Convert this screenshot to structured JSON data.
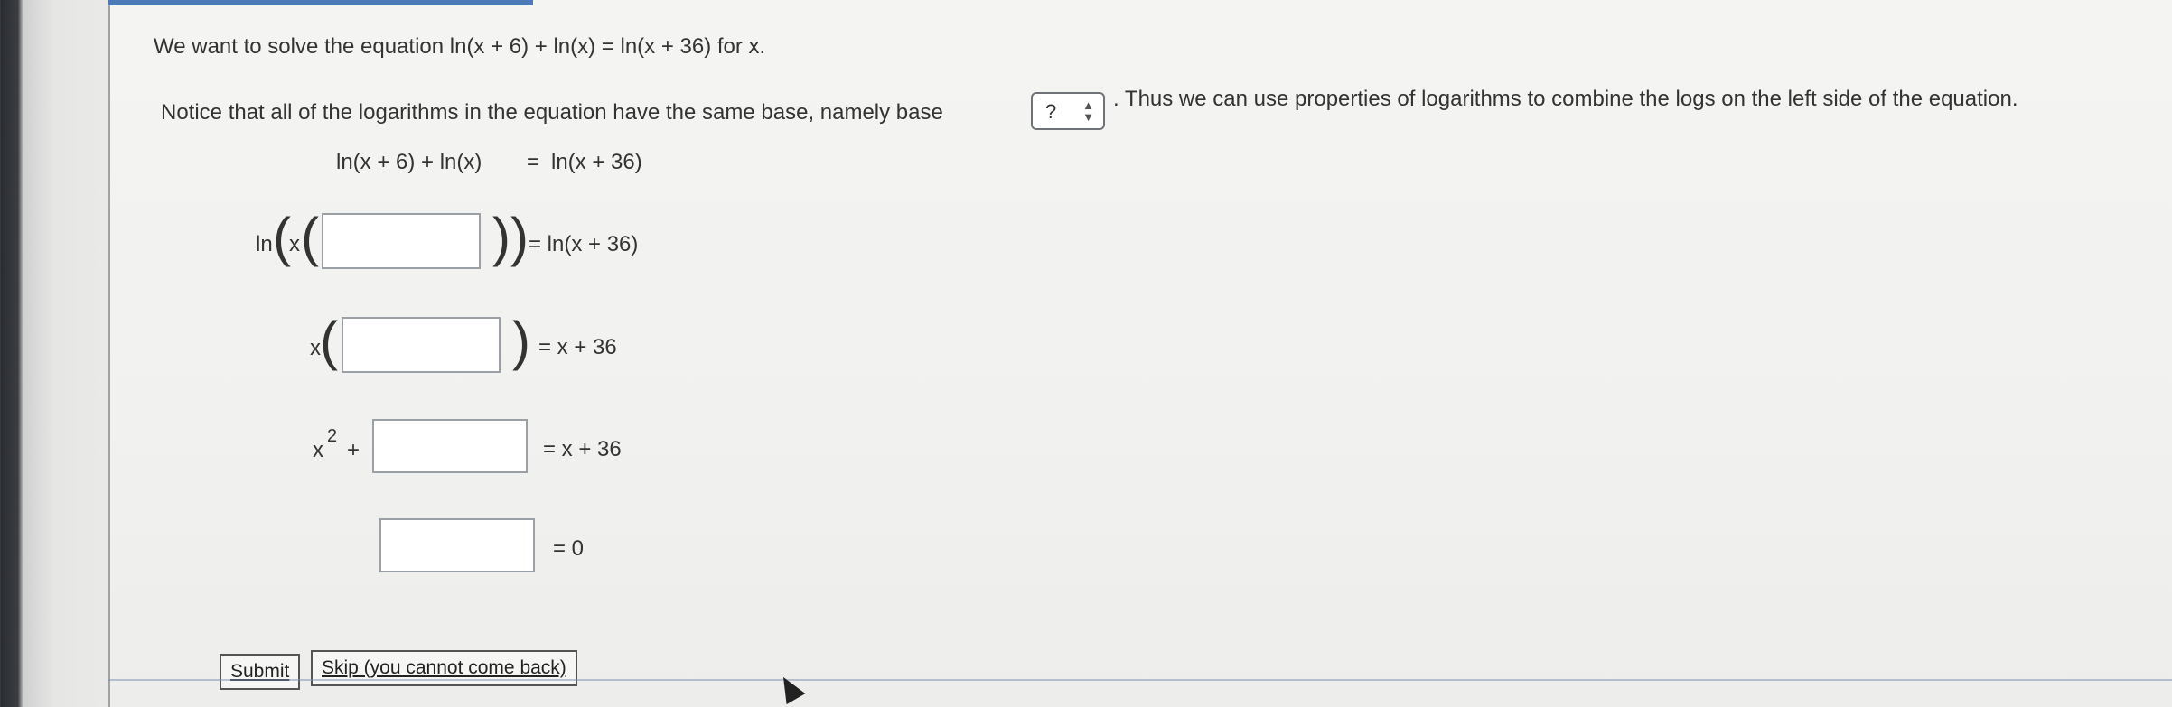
{
  "problem": {
    "intro": "We want to solve the equation ln(x + 6) + ln(x) = ln(x + 36) for x.",
    "notice_before": "Notice that all of the logarithms in the equation have the same base, namely base",
    "base_value": "?",
    "notice_after": ". Thus we can use properties of logarithms to combine the logs on the left side of the equation."
  },
  "steps": {
    "step1_left": "ln(x + 6) + ln(x)",
    "step1_eq": "=",
    "step1_right": "ln(x + 36)",
    "step2_prefix": "ln",
    "step2_x": "x",
    "step2_right": "= ln(x + 36)",
    "step3_x": "x",
    "step3_right": "= x + 36",
    "step4_prefix": "x",
    "step4_exp": "2",
    "step4_plus": "+",
    "step4_right": "= x + 36",
    "step5_right": "= 0"
  },
  "buttons": {
    "submit": "Submit",
    "skip": "Skip (you cannot come back)"
  }
}
